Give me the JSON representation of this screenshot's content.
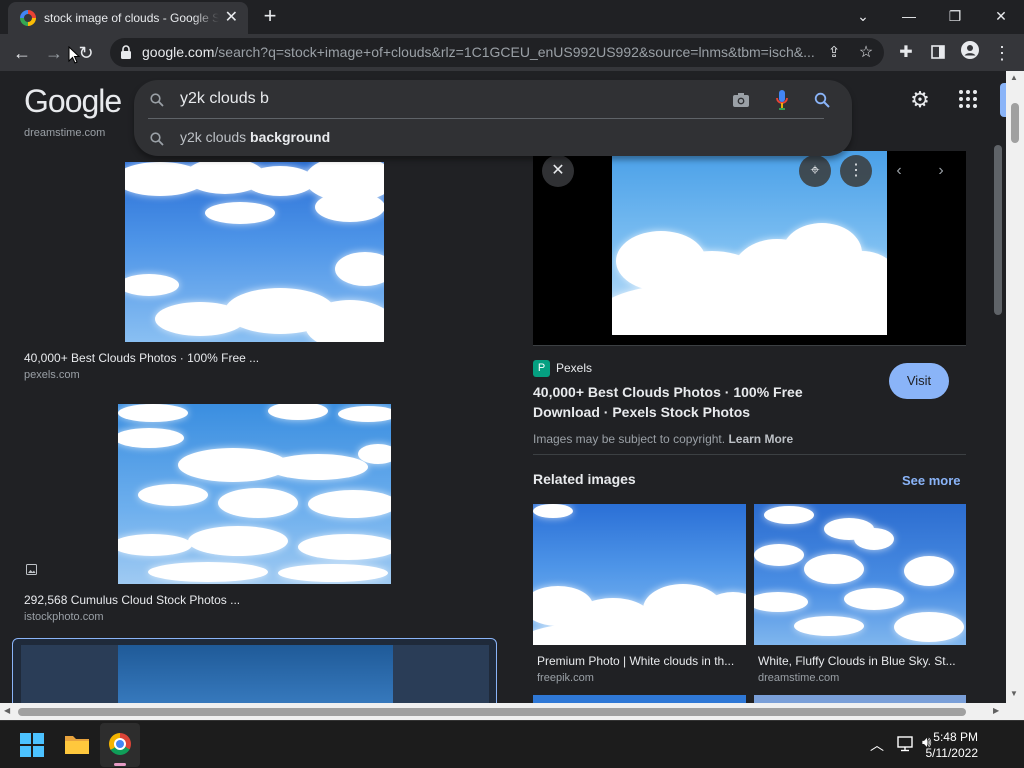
{
  "browser": {
    "tab_title": "stock image of clouds - Google Search",
    "url_host": "google.com",
    "url_path": "/search?q=stock+image+of+clouds&rlz=1C1GCEU_enUS992US992&source=lnms&tbm=isch&..."
  },
  "google": {
    "logo_text": "Google",
    "search_query": "y2k clouds b",
    "suggestion_prefix": "y2k clouds ",
    "suggestion_bold": "background"
  },
  "results": [
    {
      "source": "dreamstime.com"
    },
    {
      "caption": "40,000+ Best Clouds Photos · 100% Free ...",
      "source": "pexels.com"
    },
    {
      "caption": "292,568 Cumulus Cloud Stock Photos ...",
      "source": "istockphoto.com"
    }
  ],
  "preview": {
    "site_name": "Pexels",
    "title_line1": "40,000+ Best Clouds Photos · 100% Free",
    "title_line2": "Download · Pexels Stock Photos",
    "copyright_text": "Images may be subject to copyright.",
    "learn_more": "Learn More",
    "visit_label": "Visit",
    "related_heading": "Related images",
    "see_more": "See more",
    "related": [
      {
        "caption": "Premium Photo | White clouds in th...",
        "source": "freepik.com"
      },
      {
        "caption": "White, Fluffy Clouds in Blue Sky. St...",
        "source": "dreamstime.com"
      }
    ]
  },
  "taskbar": {
    "time": "5:48 PM",
    "date": "5/11/2022"
  },
  "colors": {
    "accent_blue": "#8ab4f8",
    "page_bg": "#202124",
    "sky_blue": "#3d86e2"
  }
}
